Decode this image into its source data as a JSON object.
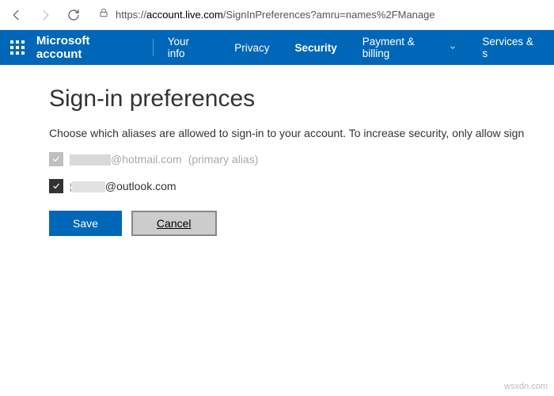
{
  "browser": {
    "url_prefix": "https://",
    "url_host": "account.live.com",
    "url_path": "/SignInPreferences?amru=names%2FManage"
  },
  "header": {
    "brand": "Microsoft account",
    "nav": {
      "your_info": "Your info",
      "privacy": "Privacy",
      "security": "Security",
      "payment": "Payment & billing",
      "services": "Services & s"
    }
  },
  "page": {
    "title": "Sign-in preferences",
    "description": "Choose which aliases are allowed to sign-in to your account. To increase security, only allow sign",
    "aliases": [
      {
        "domain": "@hotmail.com",
        "suffix": "(primary alias)",
        "checked": true,
        "enabled": false
      },
      {
        "domain": "@outlook.com",
        "suffix": "",
        "checked": true,
        "enabled": true
      }
    ],
    "buttons": {
      "save": "Save",
      "cancel": "Cancel"
    }
  },
  "watermark": "wsxdn.com"
}
